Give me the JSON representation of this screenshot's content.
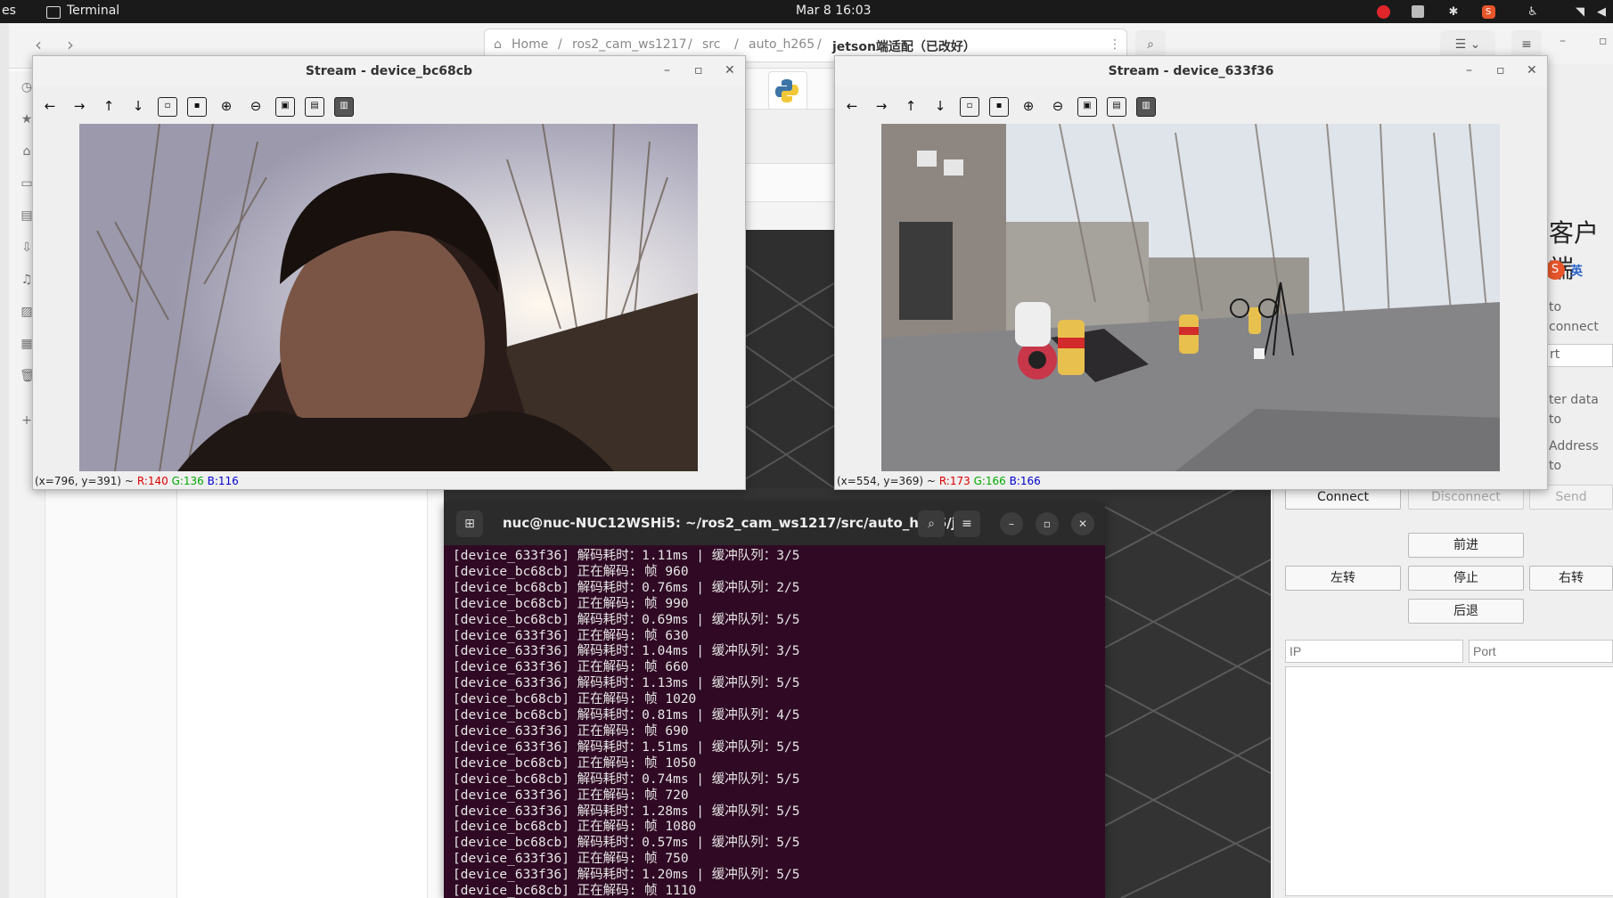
{
  "topbar": {
    "activities": "es",
    "app_name": "Terminal",
    "clock": "Mar 8  16:03"
  },
  "file_manager": {
    "path": [
      "Home",
      "ros2_cam_ws1217",
      "src",
      "auto_h265",
      "jetson端适配（已改好）"
    ]
  },
  "stream_left": {
    "title": "Stream - device_bc68cb",
    "status_coords": "(x=796, y=391) ~",
    "status_r": "R:140",
    "status_g": "G:136",
    "status_b": "B:116"
  },
  "stream_right": {
    "title": "Stream - device_633f36",
    "status_coords": "(x=554, y=369) ~",
    "status_r": "R:173",
    "status_g": "G:166",
    "status_b": "B:166"
  },
  "terminal": {
    "title": "nuc@nuc-NUC12WSHi5: ~/ros2_cam_ws1217/src/auto_h265/je...",
    "lines": [
      "[device_633f36] 解码耗时：1.11ms | 缓冲队列：3/5",
      "[device_bc68cb] 正在解码: 帧 960",
      "[device_bc68cb] 解码耗时：0.76ms | 缓冲队列：2/5",
      "[device_bc68cb] 正在解码: 帧 990",
      "[device_bc68cb] 解码耗时：0.69ms | 缓冲队列：5/5",
      "[device_633f36] 正在解码: 帧 630",
      "[device_633f36] 解码耗时：1.04ms | 缓冲队列：3/5",
      "[device_633f36] 正在解码: 帧 660",
      "[device_633f36] 解码耗时：1.13ms | 缓冲队列：5/5",
      "[device_bc68cb] 正在解码: 帧 1020",
      "[device_bc68cb] 解码耗时：0.81ms | 缓冲队列：4/5",
      "[device_633f36] 正在解码: 帧 690",
      "[device_633f36] 解码耗时：1.51ms | 缓冲队列：5/5",
      "[device_bc68cb] 正在解码: 帧 1050",
      "[device_bc68cb] 解码耗时：0.74ms | 缓冲队列：5/5",
      "[device_633f36] 正在解码: 帧 720",
      "[device_633f36] 解码耗时：1.28ms | 缓冲队列：5/5",
      "[device_bc68cb] 正在解码: 帧 1080",
      "[device_bc68cb] 解码耗时：0.57ms | 缓冲队列：5/5",
      "[device_633f36] 正在解码: 帧 750",
      "[device_633f36] 解码耗时：1.20ms | 缓冲队列：5/5",
      "[device_bc68cb] 正在解码: 帧 1110"
    ]
  },
  "client": {
    "title_fragment": "客户端",
    "ime_label": "英",
    "field_connect": "to connect",
    "field_port": "rt",
    "field_data": "ter data to",
    "field_address": "Address to",
    "connect": "Connect",
    "disconnect": "Disconnect",
    "send": "Send",
    "forward": "前进",
    "left": "左转",
    "stop": "停止",
    "right": "右转",
    "back": "后退",
    "ip_placeholder": "IP",
    "port_placeholder": "Port"
  }
}
